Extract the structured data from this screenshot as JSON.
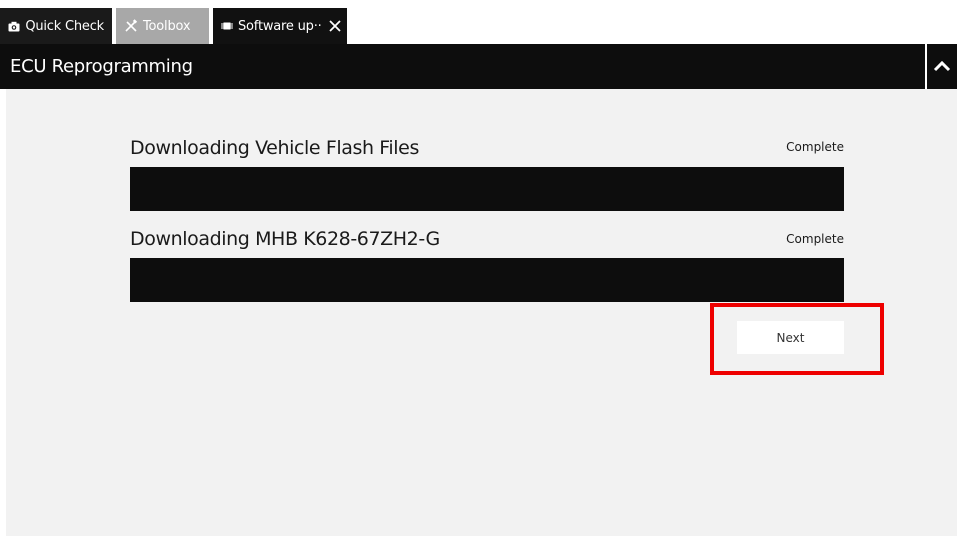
{
  "tabs": [
    {
      "label": "Quick Check",
      "icon": "camera-icon",
      "active": false
    },
    {
      "label": "Toolbox",
      "icon": "tools-icon",
      "active": false
    },
    {
      "label": "Software up··",
      "icon": "chip-icon",
      "active": true
    }
  ],
  "header": {
    "title": "ECU Reprogramming"
  },
  "downloads": [
    {
      "title": "Downloading Vehicle Flash Files",
      "status": "Complete",
      "progress": 1.0
    },
    {
      "title": "Downloading MHB K628-67ZH2-G",
      "status": "Complete",
      "progress": 1.0
    }
  ],
  "actions": {
    "next_label": "Next"
  },
  "colors": {
    "header_bg": "#0d0d0d",
    "progress_fill": "#0d0d0d",
    "content_bg": "#f2f2f2",
    "highlight": "#ee0000",
    "toolbox_tab": "#a8a8a8"
  }
}
